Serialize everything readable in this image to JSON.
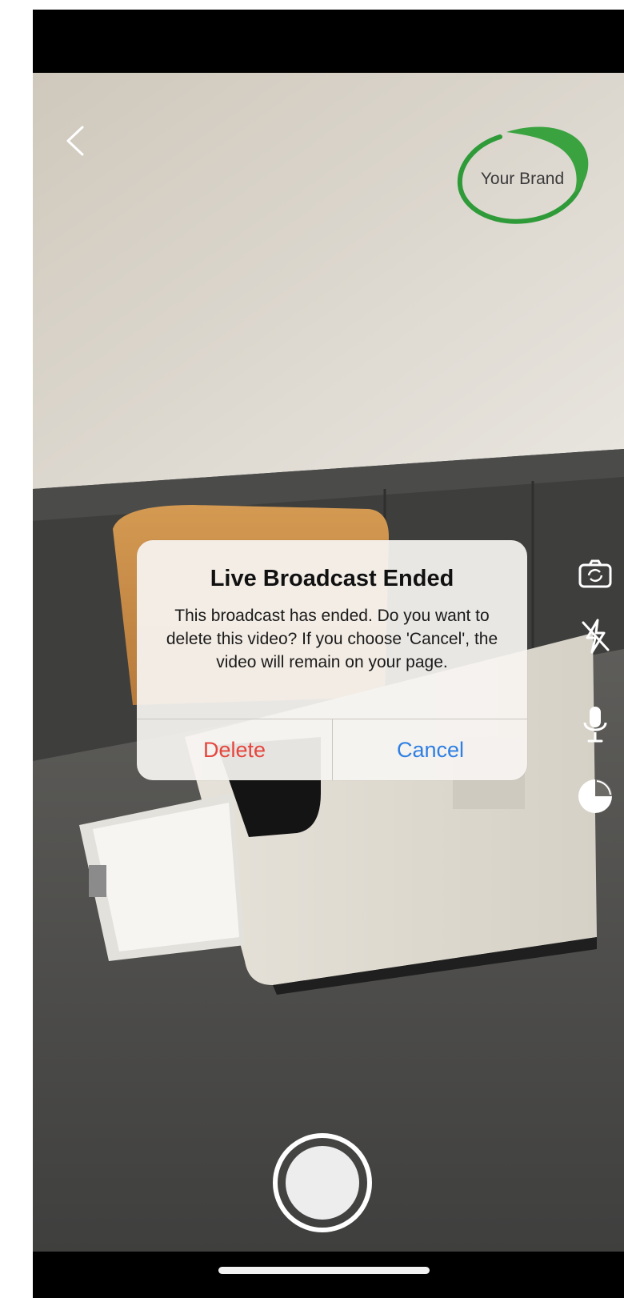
{
  "brand": {
    "logo_text": "Your Brand",
    "accent": "#2e9a38"
  },
  "icons": {
    "back": "chevron-left-icon",
    "switch_camera": "camera-switch-icon",
    "flash": "flash-off-icon",
    "microphone": "microphone-icon",
    "filter": "filter-icon",
    "record": "record-icon"
  },
  "alert": {
    "title": "Live Broadcast Ended",
    "message": "This broadcast has ended. Do you want to delete this video? If you choose 'Cancel', the video will remain on your page.",
    "buttons": {
      "delete": "Delete",
      "cancel": "Cancel"
    },
    "colors": {
      "destructive": "#e5453d",
      "default": "#2f7fe3"
    }
  }
}
